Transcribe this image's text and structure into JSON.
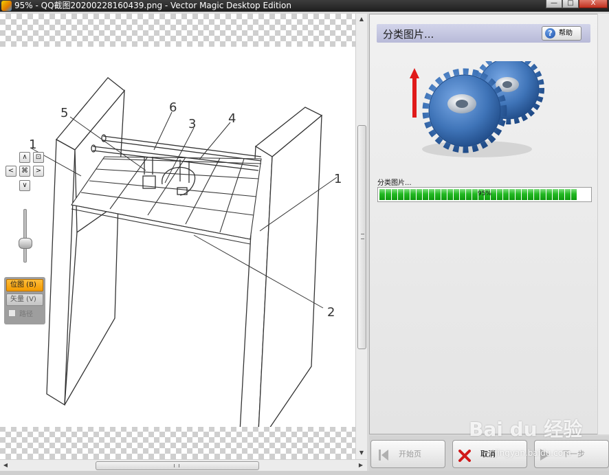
{
  "window": {
    "title": "95% - QQ截图20200228160439.png - Vector Magic Desktop Edition",
    "buttons": {
      "minimize": "—",
      "maximize": "□",
      "close": "X"
    }
  },
  "drawing": {
    "callouts": [
      "1",
      "2",
      "3",
      "4",
      "5",
      "6",
      "1"
    ]
  },
  "nav": {
    "up": "∧",
    "down": "∨",
    "left": "<",
    "right": ">",
    "center": "⌘",
    "fit": "⊡",
    "zoom_level": 0.6
  },
  "modes": {
    "bitmap_label": "位图 (B)",
    "vector_label": "矢量 (V)",
    "path_label": "路径",
    "active": "bitmap"
  },
  "panel": {
    "title": "分类图片...",
    "help_label": "帮助",
    "progress_label": "分类图片...",
    "progress_text": "95%",
    "progress_value": 0.95
  },
  "footer": {
    "home_label": "开始页",
    "cancel_label": "取消",
    "next_label": "下一步"
  },
  "watermark": {
    "brand": "Bai du 经验",
    "url": "jingyan.baidu.com"
  },
  "colors": {
    "accent": "#f29a00",
    "progress": "#22b822",
    "header": "#c4c6e0",
    "gear": "#3f74b8",
    "arrow": "#e01a1a"
  }
}
